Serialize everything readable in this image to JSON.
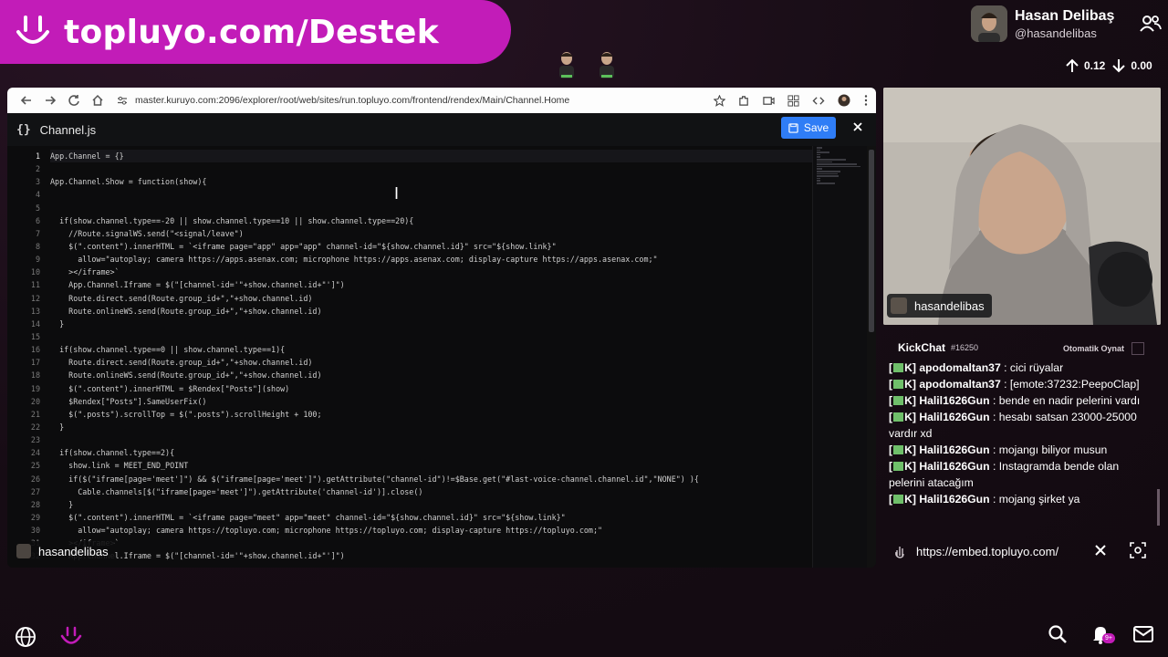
{
  "banner": {
    "text": "topluyo.com/Destek"
  },
  "profile": {
    "name": "Hasan Delibaş",
    "handle": "@hasandelibas"
  },
  "net": {
    "up": "0.12",
    "down": "0.00"
  },
  "browser": {
    "url": "master.kuruyo.com:2096/explorer/root/web/sites/run.topluyo.com/frontend/rendex/Main/Channel.Home"
  },
  "editor": {
    "file_icon": "{}",
    "file_name": "Channel.js",
    "save_label": "Save",
    "line_numbers": [
      "1",
      "2",
      "3",
      "4",
      "5",
      "6",
      "7",
      "8",
      "9",
      "10",
      "11",
      "12",
      "13",
      "14",
      "15",
      "16",
      "17",
      "18",
      "19",
      "20",
      "21",
      "22",
      "23",
      "24",
      "25",
      "26",
      "27",
      "28",
      "29",
      "30",
      "31",
      "32"
    ],
    "lines": [
      "App.Channel = {}",
      "",
      "App.Channel.Show = function(show){",
      "",
      "",
      "  if(show.channel.type==-20 || show.channel.type==10 || show.channel.type==20){",
      "    //Route.signalWS.send(\"<signal/leave\")",
      "    $(\".content\").innerHTML = `<iframe page=\"app\" app=\"app\" channel-id=\"${show.channel.id}\" src=\"${show.link}\"",
      "      allow=\"autoplay; camera https://apps.asenax.com; microphone https://apps.asenax.com; display-capture https://apps.asenax.com;\"",
      "    ></iframe>`",
      "    App.Channel.Iframe = $(\"[channel-id='\"+show.channel.id+\"']\")",
      "    Route.direct.send(Route.group_id+\",\"+show.channel.id)",
      "    Route.onlineWS.send(Route.group_id+\",\"+show.channel.id)",
      "  }",
      "",
      "  if(show.channel.type==0 || show.channel.type==1){",
      "    Route.direct.send(Route.group_id+\",\"+show.channel.id)",
      "    Route.onlineWS.send(Route.group_id+\",\"+show.channel.id)",
      "    $(\".content\").innerHTML = $Rendex[\"Posts\"](show)",
      "    $Rendex[\"Posts\"].SameUserFix()",
      "    $(\".posts\").scrollTop = $(\".posts\").scrollHeight + 100;",
      "  }",
      "",
      "  if(show.channel.type==2){",
      "    show.link = MEET_END_POINT",
      "    if($(\"iframe[page='meet']\") && $(\"iframe[page='meet']\").getAttribute(\"channel-id\")!=$Base.get(\"#last-voice-channel.channel.id\",\"NONE\") ){",
      "      Cable.channels[$(\"iframe[page='meet']\").getAttribute('channel-id')].close()",
      "    }",
      "    $(\".content\").innerHTML = `<iframe page=\"meet\" app=\"meet\" channel-id=\"${show.channel.id}\" src=\"${show.link}\"",
      "      allow=\"autoplay; camera https://topluyo.com; microphone https://topluyo.com; display-capture https://topluyo.com;\"",
      "    ></iframe>`",
      "    App.Channel.Iframe = $(\"[channel-id='\"+show.channel.id+\"']\")"
    ],
    "overlay_user": "hasandelibas"
  },
  "webcam": {
    "label": "hasandelibas"
  },
  "chat": {
    "title": "KickChat",
    "count": "#16250",
    "autoplay_label": "Otomatik Oynat",
    "messages": [
      {
        "prefix": "[",
        "suffix": "K]",
        "user": "apodomaltan37",
        "text": " : cici rüyalar"
      },
      {
        "prefix": "[",
        "suffix": "K]",
        "user": "apodomaltan37",
        "text": " : [emote:37232:PeepoClap]"
      },
      {
        "prefix": "[",
        "suffix": "K]",
        "user": "Halil1626Gun",
        "text": " : bende en nadir pelerini vardı"
      },
      {
        "prefix": "[",
        "suffix": "K]",
        "user": "Halil1626Gun",
        "text": " : hesabı satsan 23000-25000 vardır xd"
      },
      {
        "prefix": "[",
        "suffix": "K]",
        "user": "Halil1626Gun",
        "text": " : mojangı biliyor musun"
      },
      {
        "prefix": "[",
        "suffix": "K]",
        "user": "Halil1626Gun",
        "text": " : Instagramda bende olan pelerini atacağım"
      },
      {
        "prefix": "[",
        "suffix": "K]",
        "user": "Halil1626Gun",
        "text": " : mojang şirket ya"
      }
    ]
  },
  "embed": {
    "url": "https://embed.topluyo.com/"
  },
  "notifications": {
    "badge": "9+"
  },
  "colors": {
    "brand": "#c21cb8",
    "save": "#2f7df6",
    "chat_badge": "#6fbf6a"
  }
}
